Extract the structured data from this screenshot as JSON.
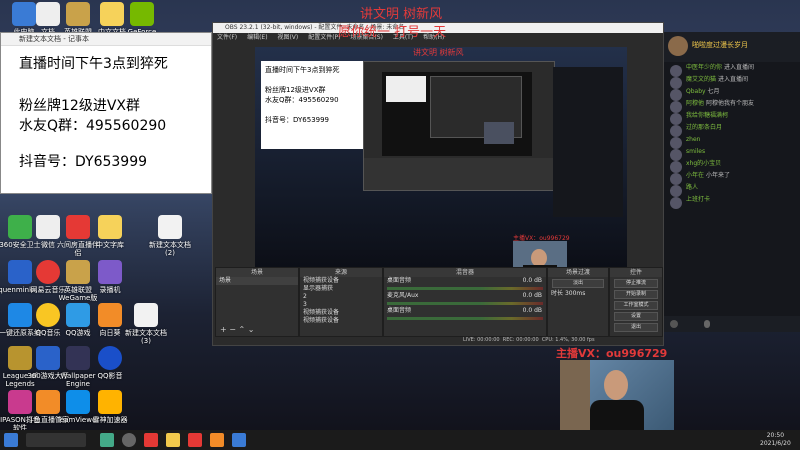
{
  "overlay_text": {
    "line1": "讲文明 树新风",
    "line2": "愿你统一 打号一天",
    "camera_caption": "主播VX：ou996729"
  },
  "notepad": {
    "title": "新建文本文档 - 记事本",
    "lines": [
      "直播时间下午3点到猝死",
      "粉丝牌12级进VX群",
      "水友Q群：495560290",
      "抖音号：DY653999"
    ]
  },
  "obs": {
    "title": "OBS 23.2.1 (32-bit, windows) - 配置文件: 未命名 - 场景: 未命名",
    "menu": [
      "文件(F)",
      "编辑(E)",
      "视图(V)",
      "配置文件(P)",
      "场景集合(S)",
      "工具(T)",
      "帮助(H)"
    ],
    "docks": {
      "scenes": {
        "header": "场景",
        "items": [
          "场景"
        ]
      },
      "sources": {
        "header": "来源",
        "items": [
          "视频捕获设备",
          "显示器捕获",
          "2",
          "3",
          "视频捕获设备",
          "视频捕获设备"
        ]
      },
      "mixer": {
        "header": "混音器",
        "channels": [
          {
            "name": "桌面音频",
            "db": "0.0 dB"
          },
          {
            "name": "麦克风/Aux",
            "db": "0.0 dB"
          },
          {
            "name": "桌面音频",
            "db": "0.0 dB"
          }
        ]
      },
      "transitions": {
        "header": "场景过渡",
        "mode": "淡出",
        "duration_label": "时长",
        "duration": "300ms"
      },
      "controls": {
        "header": "控件",
        "buttons": [
          "停止推流",
          "开始录制",
          "工作室模式",
          "设置",
          "退出"
        ]
      }
    },
    "status": {
      "live": "LIVE: 00:00:00",
      "rec": "REC: 00:00:00",
      "cpu": "CPU: 1.4%, 30.00 fps"
    }
  },
  "chat": {
    "header_name": "啪啦度过漫长岁月",
    "messages": [
      {
        "name": "中医年少的你",
        "text": "进入直播间"
      },
      {
        "name": "魔艾文的猫",
        "text": "进入直播间"
      },
      {
        "name": "Qbaby",
        "text": "七月"
      },
      {
        "name": "阿穆他",
        "text": "阿穆他我有个朋友"
      },
      {
        "name": "我给你糖福满柯",
        "text": ""
      },
      {
        "name": "过的那条白月",
        "text": ""
      },
      {
        "name": "zhen",
        "text": ""
      },
      {
        "name": "smiles",
        "text": ""
      },
      {
        "name": "xhg的小宝贝",
        "text": ""
      },
      {
        "name": "小年在",
        "text": "小年来了"
      },
      {
        "name": "路人",
        "text": ""
      },
      {
        "name": "上班打卡",
        "text": ""
      }
    ]
  },
  "desktop_icons": [
    {
      "label": "此电脑"
    },
    {
      "label": "文档"
    },
    {
      "label": "英雄联盟"
    },
    {
      "label": "中文文档"
    },
    {
      "label": "GeForce"
    },
    {
      "label": "360安全卫士"
    },
    {
      "label": "微信"
    },
    {
      "label": "六间房直播伴侣"
    },
    {
      "label": "中文字库"
    },
    {
      "label": "新建文本文档(2)"
    },
    {
      "label": "quenminki..."
    },
    {
      "label": "网易云音乐"
    },
    {
      "label": "英雄联盟WeGame版"
    },
    {
      "label": "录播机"
    },
    {
      "label": "一键还原系统"
    },
    {
      "label": "QQ音乐"
    },
    {
      "label": "QQ游戏"
    },
    {
      "label": "向日葵"
    },
    {
      "label": "新建文本文档(3)"
    },
    {
      "label": "League of Legends"
    },
    {
      "label": "360游戏大厅"
    },
    {
      "label": "Wallpaper Engine"
    },
    {
      "label": "QQ影音"
    },
    {
      "label": "IPASON打包软件"
    },
    {
      "label": "斗鱼直播管家"
    },
    {
      "label": "TeamViewer"
    },
    {
      "label": "雷神加速器"
    }
  ],
  "taskbar": {
    "time": "20:50",
    "date": "2021/6/20"
  }
}
